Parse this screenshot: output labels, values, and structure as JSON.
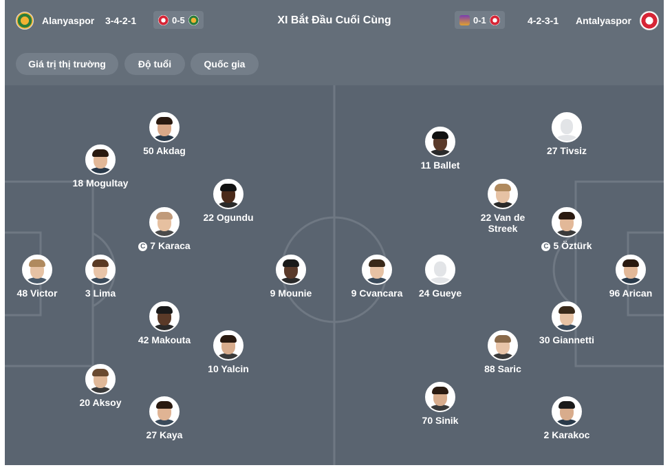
{
  "header": {
    "title": "XI Bắt Đầu Cuối Cùng",
    "home": {
      "name": "Alanyaspor",
      "formation": "3-4-2-1",
      "crest": "alanyaspor-crest-icon",
      "last_result": "0-5"
    },
    "away": {
      "name": "Antalyaspor",
      "formation": "4-2-3-1",
      "crest": "antalyaspor-crest-icon",
      "last_result": "0-1"
    }
  },
  "filters": [
    "Giá trị thị trường",
    "Độ tuổi",
    "Quốc gia"
  ],
  "colors": {
    "panel": "#5a6470",
    "header": "#646e79",
    "chip": "#747e89",
    "pitch_lines": "#6f7883"
  },
  "home_players": [
    {
      "label": "48 Victor"
    },
    {
      "label": "3 Lima"
    },
    {
      "label": "18 Mogultay"
    },
    {
      "label": "20 Aksoy"
    },
    {
      "label": "50 Akdag"
    },
    {
      "label": "7 Karaca",
      "captain": true
    },
    {
      "label": "42 Makouta"
    },
    {
      "label": "27 Kaya"
    },
    {
      "label": "22 Ogundu"
    },
    {
      "label": "10 Yalcin"
    },
    {
      "label": "9 Mounie"
    }
  ],
  "away_players": [
    {
      "label": "96 Arican"
    },
    {
      "label": "27 Tivsiz",
      "placeholder_photo": true
    },
    {
      "label": "5 Öztürk",
      "captain": true
    },
    {
      "label": "30 Giannetti"
    },
    {
      "label": "2 Karakoc"
    },
    {
      "label": "22 Van de Streek"
    },
    {
      "label": "88 Saric"
    },
    {
      "label": "11 Ballet"
    },
    {
      "label": "24 Gueye",
      "placeholder_photo": true
    },
    {
      "label": "70 Sinik"
    },
    {
      "label": "9 Cvancara"
    }
  ]
}
